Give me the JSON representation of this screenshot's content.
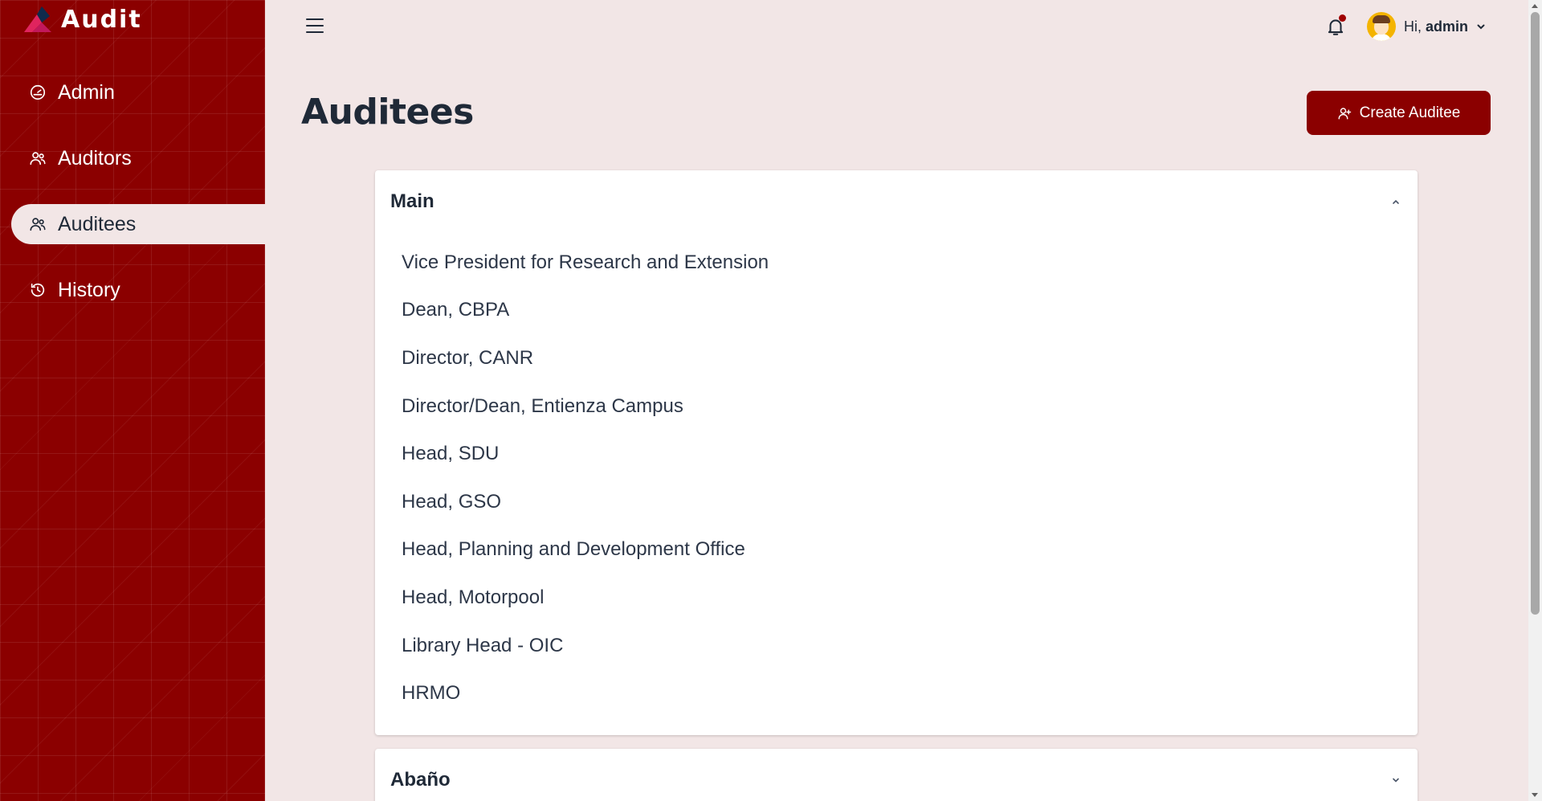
{
  "app": {
    "name": "Audit"
  },
  "sidebar": {
    "items": [
      {
        "label": "Admin",
        "icon": "dashboard-gauge-icon",
        "active": false
      },
      {
        "label": "Auditors",
        "icon": "users-icon",
        "active": false
      },
      {
        "label": "Auditees",
        "icon": "users-icon",
        "active": true
      },
      {
        "label": "History",
        "icon": "history-icon",
        "active": false
      }
    ]
  },
  "topbar": {
    "greeting": "Hi,",
    "username": "admin"
  },
  "page": {
    "title": "Auditees",
    "create_button_label": "Create Auditee"
  },
  "accordions": [
    {
      "title": "Main",
      "expanded": true,
      "items": [
        "Vice President for Research and Extension",
        "Dean, CBPA",
        "Director, CANR",
        "Director/Dean, Entienza Campus",
        "Head, SDU",
        "Head, GSO",
        "Head, Planning and Development Office",
        "Head, Motorpool",
        "Library Head - OIC",
        "HRMO"
      ]
    },
    {
      "title": "Abaño",
      "expanded": false,
      "items": []
    }
  ],
  "colors": {
    "brand": "#8b0000",
    "background": "#f2e6e6",
    "notification_dot": "#a00000"
  }
}
